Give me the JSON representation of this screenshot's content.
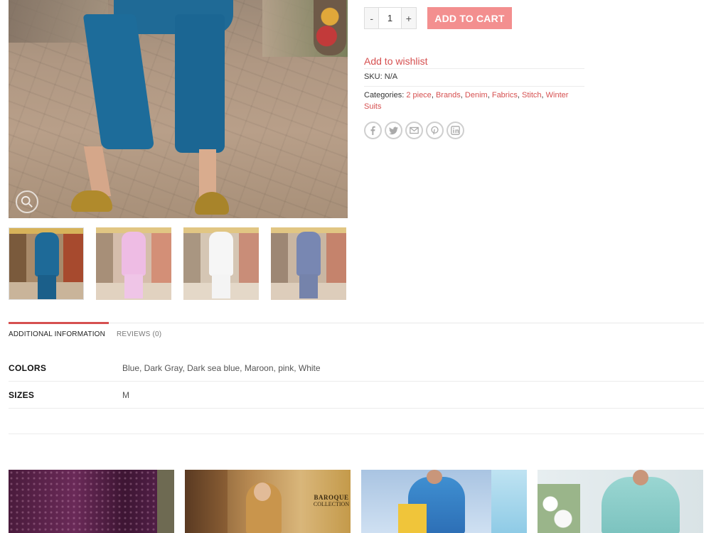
{
  "product": {
    "quantity": "1",
    "qty_minus": "-",
    "qty_plus": "+",
    "add_to_cart": "ADD TO CART",
    "wishlist": "Add to wishlist",
    "sku_label": "SKU:",
    "sku_value": "N/A",
    "categories_label": "Categories:",
    "categories": [
      "2 piece",
      "Brands",
      "Denim",
      "Fabrics",
      "Stitch",
      "Winter Suits"
    ],
    "share_icons": [
      "facebook-icon",
      "twitter-icon",
      "email-icon",
      "pinterest-icon",
      "linkedin-icon"
    ]
  },
  "gallery": {
    "thumbnails": [
      {
        "color": "#1e6a98",
        "name": "blue"
      },
      {
        "color": "#e9a6dc",
        "name": "pink"
      },
      {
        "color": "#f4f4f4",
        "name": "white"
      },
      {
        "color": "#4c5f99",
        "name": "dark sea blue"
      }
    ]
  },
  "tabs": [
    {
      "label": "ADDITIONAL INFORMATION",
      "active": true
    },
    {
      "label": "REVIEWS (0)",
      "active": false
    }
  ],
  "attributes": [
    {
      "key": "COLORS",
      "value": "Blue, Dark Gray, Dark sea blue, Maroon, pink, White"
    },
    {
      "key": "SIZES",
      "value": "M"
    }
  ],
  "related": {
    "brand_label_top": "BAROQUE",
    "brand_label_bottom": "COLLECTION"
  },
  "colors": {
    "accent": "#d65050",
    "button": "#f38f8f"
  }
}
